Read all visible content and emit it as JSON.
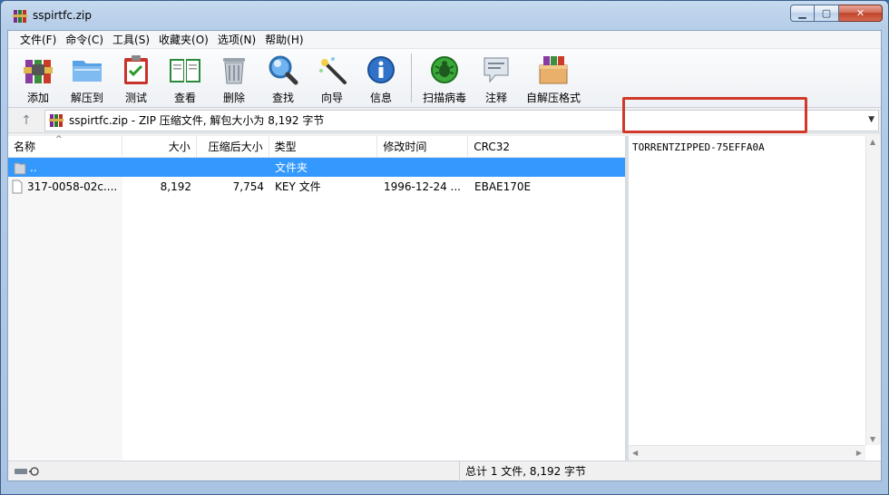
{
  "window": {
    "title": "sspirtfc.zip"
  },
  "menu": [
    "文件(F)",
    "命令(C)",
    "工具(S)",
    "收藏夹(O)",
    "选项(N)",
    "帮助(H)"
  ],
  "toolbar": {
    "add": "添加",
    "extract_to": "解压到",
    "test": "测试",
    "view": "查看",
    "delete": "删除",
    "find": "查找",
    "wizard": "向导",
    "info": "信息",
    "scan_virus": "扫描病毒",
    "comment": "注释",
    "sfx": "自解压格式"
  },
  "address": {
    "text": "sspirtfc.zip - ZIP 压缩文件, 解包大小为 8,192 字节"
  },
  "columns": {
    "name": "名称",
    "size": "大小",
    "packed": "压缩后大小",
    "type": "类型",
    "modified": "修改时间",
    "crc": "CRC32"
  },
  "rows": [
    {
      "name": "..",
      "size": "",
      "packed": "",
      "type": "文件夹",
      "modified": "",
      "crc": ""
    },
    {
      "name": "317-0058-02c....",
      "size": "8,192",
      "packed": "7,754",
      "type": "KEY 文件",
      "modified": "1996-12-24 ...",
      "crc": "EBAE170E"
    }
  ],
  "comment": {
    "text": "TORRENTZIPPED-75EFFA0A"
  },
  "status": {
    "text": "总计 1 文件, 8,192 字节"
  },
  "colors": {
    "selection": "#3399ff",
    "highlight_box": "#d13a2a"
  }
}
